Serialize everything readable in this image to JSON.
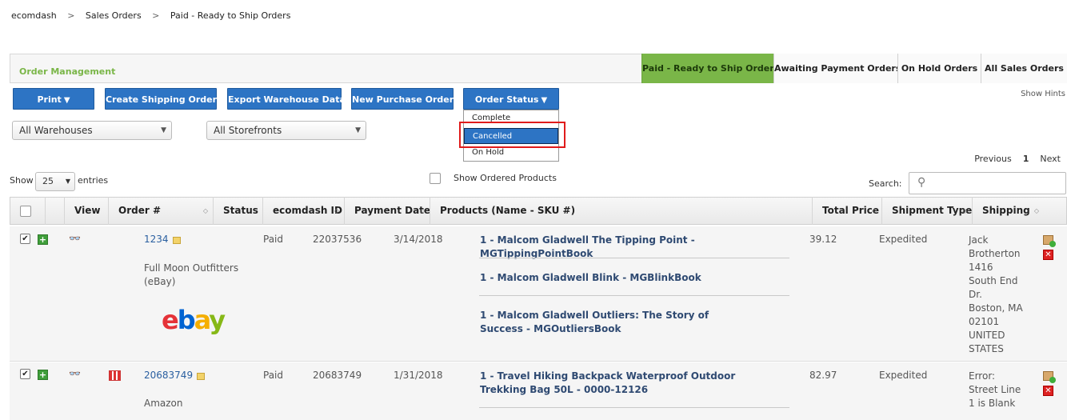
{
  "breadcrumb": [
    "ecomdash",
    "Sales Orders",
    "Paid - Ready to Ship Orders"
  ],
  "breadcrumb_sep": ">",
  "header": {
    "title": "Order Management",
    "tabs": [
      "Paid - Ready to Ship Orders",
      "Awaiting Payment Orders",
      "On Hold Orders",
      "All Sales Orders"
    ]
  },
  "toolbar": {
    "print": "Print",
    "create_shipping": "Create Shipping Orders",
    "export_warehouse": "Export Warehouse Data",
    "new_po": "New Purchase Order",
    "order_status": "Order Status",
    "show_hints": "Show Hints"
  },
  "filters": {
    "warehouse": "All Warehouses",
    "storefront": "All Storefronts"
  },
  "status_menu": [
    "Complete",
    "Cancelled",
    "On Hold"
  ],
  "pager": {
    "prev": "Previous",
    "page": "1",
    "next": "Next"
  },
  "entries": {
    "show": "Show",
    "value": "25",
    "suffix": "entries"
  },
  "show_ordered_products": "Show Ordered Products",
  "search_label": "Search:",
  "columns": [
    "View",
    "Order #",
    "Status",
    "ecomdash ID",
    "Payment Date",
    "Products (Name - SKU #)",
    "Total Price",
    "Shipment Type",
    "Shipping"
  ],
  "rows": [
    {
      "order": "1234",
      "store": "Full Moon Outfitters (eBay)",
      "status": "Paid",
      "ecomdash_id": "22037536",
      "payment_date": "3/14/2018",
      "products": [
        "1 - Malcom Gladwell The Tipping Point - MGTippingPointBook",
        "1 - Malcom Gladwell Blink - MGBlinkBook",
        "1 - Malcom Gladwell Outliers: The Story of Success - MGOutliersBook"
      ],
      "total": "39.12",
      "shipment": "Expedited",
      "shipping": [
        "Jack",
        "Brotherton",
        "1416",
        "South End",
        "Dr.",
        "Boston, MA",
        "02101",
        "UNITED",
        "STATES"
      ],
      "logo": "ebay"
    },
    {
      "order": "20683749",
      "store": "Amazon",
      "status": "Paid",
      "ecomdash_id": "20683749",
      "payment_date": "1/31/2018",
      "products": [
        "1 - Travel Hiking Backpack Waterproof Outdoor Trekking Bag 50L - 0000-12126"
      ],
      "total": "82.97",
      "shipment": "Expedited",
      "shipping": [
        "Error:",
        "Street Line",
        "1 is Blank"
      ]
    }
  ],
  "colors": {
    "accent_green": "#7ab648",
    "button_blue": "#2d74c4",
    "highlight_red": "#e01b1b"
  },
  "icons": [
    "binoculars-icon",
    "add-icon",
    "note-icon",
    "store-icon",
    "ship-package-icon",
    "delete-icon",
    "search-icon",
    "ebay-logo"
  ]
}
